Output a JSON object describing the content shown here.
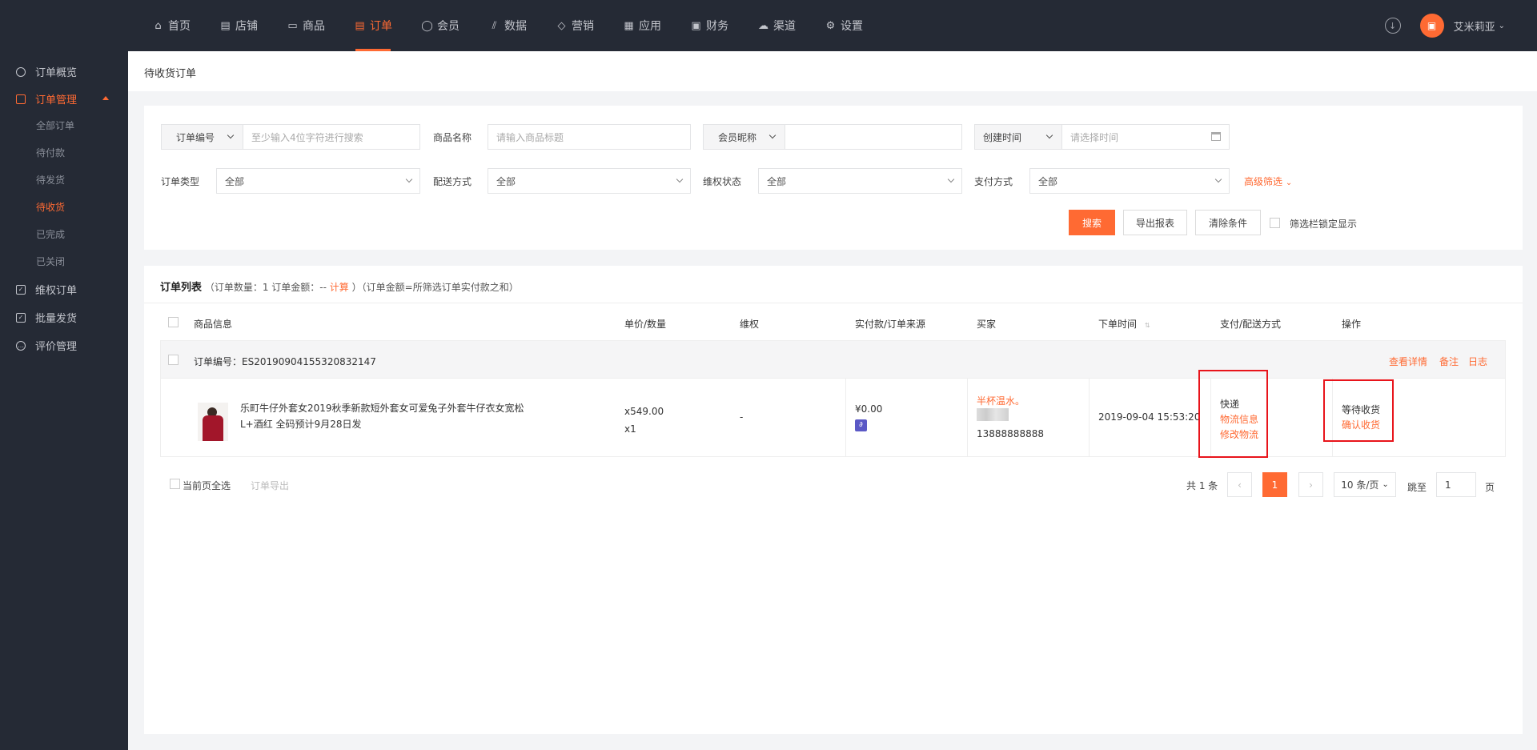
{
  "nav": {
    "items": [
      {
        "label": "首页",
        "icon": "home-icon"
      },
      {
        "label": "店铺",
        "icon": "store-icon"
      },
      {
        "label": "商品",
        "icon": "product-icon"
      },
      {
        "label": "订单",
        "icon": "order-icon"
      },
      {
        "label": "会员",
        "icon": "member-icon"
      },
      {
        "label": "数据",
        "icon": "chart-icon"
      },
      {
        "label": "营销",
        "icon": "tag-icon"
      },
      {
        "label": "应用",
        "icon": "app-icon"
      },
      {
        "label": "财务",
        "icon": "finance-icon"
      },
      {
        "label": "渠道",
        "icon": "channel-icon"
      },
      {
        "label": "设置",
        "icon": "settings-icon"
      }
    ],
    "active": "订单",
    "user_name": "艾米莉亚"
  },
  "sidebar": {
    "overview": "订单概览",
    "manage": "订单管理",
    "sub": [
      "全部订单",
      "待付款",
      "待发货",
      "待收货",
      "已完成",
      "已关闭"
    ],
    "active_sub": "待收货",
    "rights": "维权订单",
    "batch": "批量发货",
    "review": "评价管理"
  },
  "page": {
    "title": "待收货订单"
  },
  "filters": {
    "order_no_select": "订单编号",
    "order_no_placeholder": "至少输入4位字符进行搜索",
    "goods_name_label": "商品名称",
    "goods_name_placeholder": "请输入商品标题",
    "member_select": "会员昵称",
    "created_select": "创建时间",
    "created_placeholder": "请选择时间",
    "order_type_label": "订单类型",
    "order_type_value": "全部",
    "delivery_label": "配送方式",
    "delivery_value": "全部",
    "rights_label": "维权状态",
    "rights_value": "全部",
    "pay_label": "支付方式",
    "pay_value": "全部",
    "advanced": "高级筛选",
    "search_btn": "搜索",
    "export_btn": "导出报表",
    "clear_btn": "清除条件",
    "lock_label": "筛选栏锁定显示"
  },
  "list": {
    "title": "订单列表",
    "summary_prefix": "（订单数量：1 订单金额：--",
    "calc": "计算",
    "summary_suffix": "）（订单金额=所筛选订单实付款之和）",
    "headers": [
      "商品信息",
      "单价/数量",
      "维权",
      "实付款/订单来源",
      "买家",
      "下单时间",
      "支付/配送方式",
      "操作"
    ]
  },
  "order": {
    "order_no": "订单编号：ES20190904155320832147",
    "view_detail": "查看详情",
    "remark": "备注",
    "log": "日志",
    "goods_title_1": "乐町牛仔外套女2019秋季新款短外套女可爱兔子外套牛仔衣女宽松",
    "goods_title_2": "L+酒红 全码预计9月28日发",
    "price": "x549.00",
    "qty": "x1",
    "rights": "-",
    "paid": "¥0.00",
    "buyer_name": "半杯温水。",
    "buyer_phone": "13888888888",
    "time": "2019-09-04 15:53:20",
    "ship_method": "快递",
    "logistics_info": "物流信息",
    "edit_logistics": "修改物流",
    "status": "等待收货",
    "confirm": "确认收货"
  },
  "footer": {
    "select_all": "当前页全选",
    "export": "订单导出",
    "total": "共 1 条",
    "page": "1",
    "page_size": "10 条/页",
    "jump": "跳至",
    "jump_value": "1",
    "page_unit": "页"
  }
}
